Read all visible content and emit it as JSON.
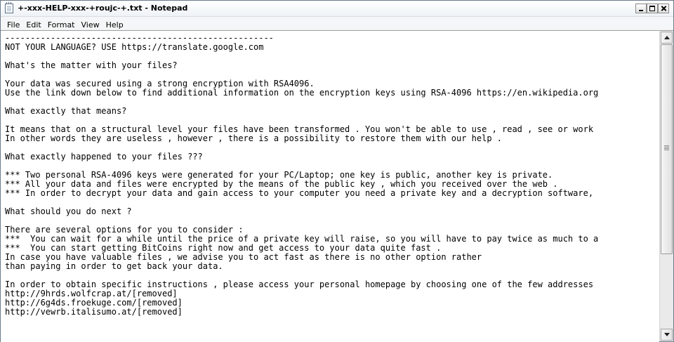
{
  "window": {
    "title": "+-xxx-HELP-xxx-+roujc-+.txt - Notepad"
  },
  "menu": [
    "File",
    "Edit",
    "Format",
    "View",
    "Help"
  ],
  "icons": {
    "app": "notepad-icon",
    "minimize": "minimize-icon",
    "maximize": "maximize-icon",
    "close": "close-icon",
    "scroll_up": "scroll-up-arrow-icon",
    "scroll_down": "scroll-down-arrow-icon"
  },
  "document": {
    "lines": [
      "-----------------------------------------------------",
      "NOT YOUR LANGUAGE? USE https://translate.google.com",
      "",
      "What's the matter with your files?",
      "",
      "Your data was secured using a strong encryption with RSA4096.",
      "Use the link down below to find additional information on the encryption keys using RSA-4096 https://en.wikipedia.org",
      "",
      "What exactly that means?",
      "",
      "It means that on a structural level your files have been transformed . You won't be able to use , read , see or work",
      "In other words they are useless , however , there is a possibility to restore them with our help .",
      "",
      "What exactly happened to your files ???",
      "",
      "*** Two personal RSA-4096 keys were generated for your PC/Laptop; one key is public, another key is private.",
      "*** All your data and files were encrypted by the means of the public key , which you received over the web .",
      "*** In order to decrypt your data and gain access to your computer you need a private key and a decryption software,",
      "",
      "What should you do next ?",
      "",
      "There are several options for you to consider :",
      "***  You can wait for a while until the price of a private key will raise, so you will have to pay twice as much to a",
      "***  You can start getting BitCoins right now and get access to your data quite fast .",
      "In case you have valuable files , we advise you to act fast as there is no other option rather",
      "than paying in order to get back your data.",
      "",
      "In order to obtain specific instructions , please access your personal homepage by choosing one of the few addresses",
      "http://9hrds.wolfcrap.at/[removed]",
      "http://6g4ds.froekuge.com/[removed]",
      "http://vewrb.italisumo.at/[removed]"
    ]
  }
}
